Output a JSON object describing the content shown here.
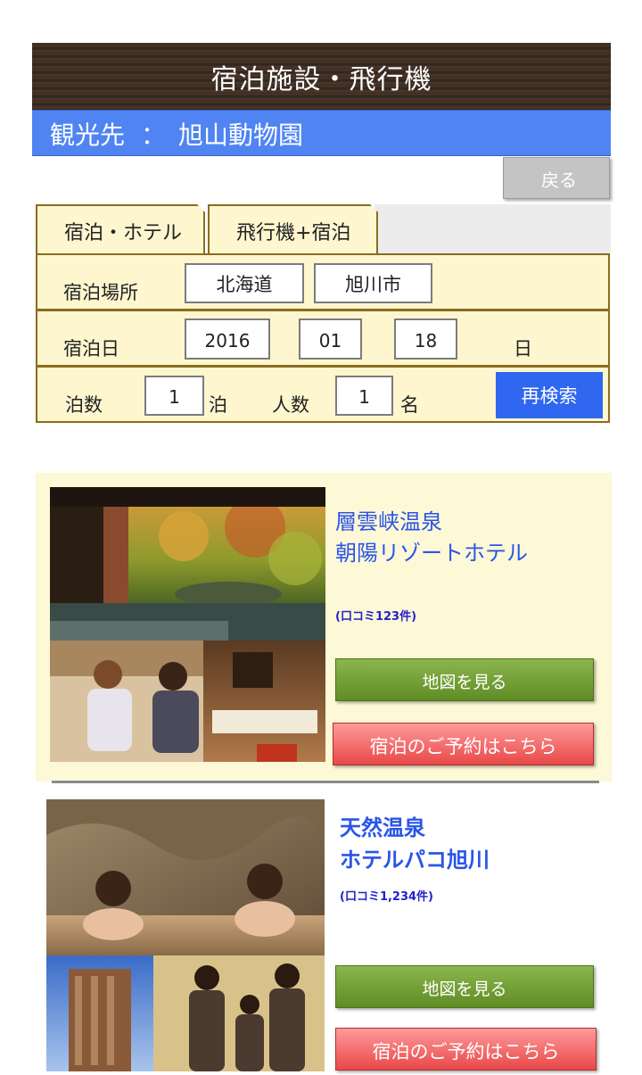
{
  "header": {
    "title": "宿泊施設・飛行機"
  },
  "destination": {
    "label": "観光先",
    "separator": "：",
    "value": "旭山動物園"
  },
  "back_label": "戻る",
  "tabs": [
    {
      "label": "宿泊・ホテル"
    },
    {
      "label": "飛行機+宿泊"
    }
  ],
  "form": {
    "place_label": "宿泊場所",
    "prefecture": "北海道",
    "city": "旭川市",
    "date_label": "宿泊日",
    "year": "2016",
    "month": "01",
    "day": "18",
    "day_unit": "日",
    "nights_label": "泊数",
    "nights": "1",
    "nights_unit": "泊",
    "people_label": "人数",
    "people": "1",
    "people_unit": "名",
    "search_label": "再検索"
  },
  "hotels": [
    {
      "name_line1": "層雲峡温泉",
      "name_line2": "朝陽リゾートホテル",
      "reviews": "(口コミ123件)",
      "map_label": "地図を見る",
      "book_label": "宿泊のご予約はこちら"
    },
    {
      "name_line1": "天然温泉",
      "name_line2": "ホテルパコ旭川",
      "reviews": "(口コミ1,234件)",
      "map_label": "地図を見る",
      "book_label": "宿泊のご予約はこちら"
    }
  ]
}
